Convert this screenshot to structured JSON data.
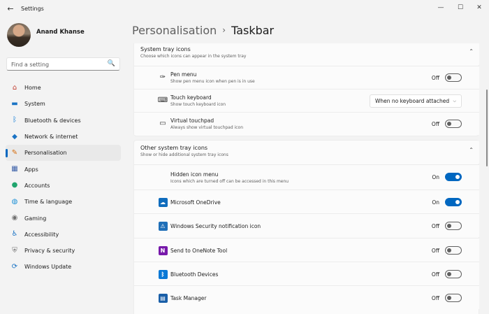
{
  "window": {
    "title": "Settings",
    "back": "←",
    "minimize": "—",
    "maximize": "☐",
    "close": "✕"
  },
  "user": {
    "name": "Anand Khanse"
  },
  "search": {
    "placeholder": "Find a setting",
    "icon": "🔍"
  },
  "nav": [
    {
      "label": "Home",
      "icon": "home-icon",
      "glyph": "⌂",
      "color": "#c0392b",
      "active": false
    },
    {
      "label": "System",
      "icon": "monitor-icon",
      "glyph": "▬",
      "color": "#1a73c4",
      "active": false
    },
    {
      "label": "Bluetooth & devices",
      "icon": "bluetooth-icon",
      "glyph": "ᛒ",
      "color": "#0a79d6",
      "active": false
    },
    {
      "label": "Network & internet",
      "icon": "wifi-icon",
      "glyph": "◆",
      "color": "#1a73c4",
      "active": false
    },
    {
      "label": "Personalisation",
      "icon": "brush-icon",
      "glyph": "✎",
      "color": "#d66b0a",
      "active": true
    },
    {
      "label": "Apps",
      "icon": "apps-icon",
      "glyph": "▦",
      "color": "#3a5fa8",
      "active": false
    },
    {
      "label": "Accounts",
      "icon": "person-icon",
      "glyph": "●",
      "color": "#20a56e",
      "active": false
    },
    {
      "label": "Time & language",
      "icon": "globe-clock-icon",
      "glyph": "◍",
      "color": "#1a8fd6",
      "active": false
    },
    {
      "label": "Gaming",
      "icon": "controller-icon",
      "glyph": "◉",
      "color": "#6f6f6f",
      "active": false
    },
    {
      "label": "Accessibility",
      "icon": "accessibility-icon",
      "glyph": "♿",
      "color": "#1a73c4",
      "active": false
    },
    {
      "label": "Privacy & security",
      "icon": "shield-icon",
      "glyph": "⛨",
      "color": "#6f6f6f",
      "active": false
    },
    {
      "label": "Windows Update",
      "icon": "update-icon",
      "glyph": "⟳",
      "color": "#1a73c4",
      "active": false
    }
  ],
  "breadcrumb": {
    "parent": "Personalisation",
    "separator": "›",
    "current": "Taskbar"
  },
  "system_tray": {
    "title": "System tray icons",
    "subtitle": "Choose which icons can appear in the system tray",
    "chevron": "⌃",
    "rows": [
      {
        "name": "pen-menu",
        "title": "Pen menu",
        "subtitle": "Show pen menu icon when pen is in use",
        "icon": "pen-icon",
        "glyph": "✑",
        "control": "toggle",
        "state": "Off",
        "on": false
      },
      {
        "name": "touch-keyboard",
        "title": "Touch keyboard",
        "subtitle": "Show touch keyboard icon",
        "icon": "keyboard-icon",
        "glyph": "⌨",
        "control": "dropdown",
        "value": "When no keyboard attached",
        "dchev": "⌵"
      },
      {
        "name": "virtual-touchpad",
        "title": "Virtual touchpad",
        "subtitle": "Always show virtual touchpad icon",
        "icon": "touchpad-icon",
        "glyph": "▭",
        "control": "toggle",
        "state": "Off",
        "on": false
      }
    ]
  },
  "other_tray": {
    "title": "Other system tray icons",
    "subtitle": "Show or hide additional system tray icons",
    "chevron": "⌃",
    "rows": [
      {
        "name": "hidden-icon-menu",
        "title": "Hidden icon menu",
        "subtitle": "Icons which are turned off can be accessed in this menu",
        "icon": "",
        "state": "On",
        "on": true
      },
      {
        "name": "onedrive",
        "title": "Microsoft OneDrive",
        "subtitle": "",
        "icon": "onedrive-icon",
        "glyph": "☁",
        "bg": "#0f6cbd",
        "state": "On",
        "on": true
      },
      {
        "name": "windows-security",
        "title": "Windows Security notification icon",
        "subtitle": "",
        "icon": "windows-security-icon",
        "glyph": "⚠",
        "bg": "#1f6fb8",
        "state": "Off",
        "on": false
      },
      {
        "name": "onenote",
        "title": "Send to OneNote Tool",
        "subtitle": "",
        "icon": "onenote-icon",
        "glyph": "N",
        "bg": "#7719aa",
        "state": "Off",
        "on": false
      },
      {
        "name": "bluetooth-devices",
        "title": "Bluetooth Devices",
        "subtitle": "",
        "icon": "bluetooth-icon",
        "glyph": "ᛒ",
        "bg": "#0a79d6",
        "state": "Off",
        "on": false
      },
      {
        "name": "task-manager",
        "title": "Task Manager",
        "subtitle": "",
        "icon": "task-manager-icon",
        "glyph": "▤",
        "bg": "#1a5fa8",
        "state": "Off",
        "on": false
      }
    ]
  },
  "colors": {
    "accent": "#0067c0",
    "background": "#f3f3f3",
    "card": "#fbfbfb"
  }
}
